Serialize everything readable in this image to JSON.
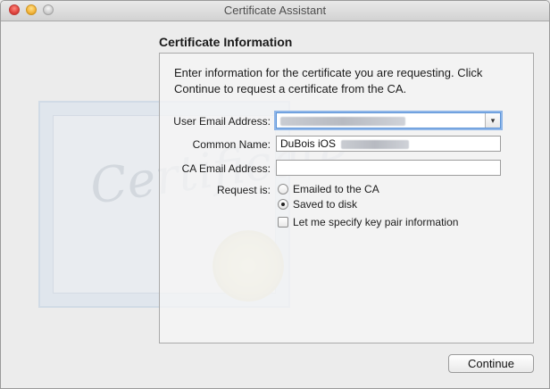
{
  "window": {
    "title": "Certificate Assistant"
  },
  "section": {
    "title": "Certificate Information"
  },
  "intro": "Enter information for the certificate you are requesting. Click Continue to request a certificate from the CA.",
  "background": {
    "certificate_word": "Certificate"
  },
  "form": {
    "user_email": {
      "label": "User Email Address:",
      "value": ""
    },
    "common_name": {
      "label": "Common Name:",
      "value": "DuBois iOS"
    },
    "ca_email": {
      "label": "CA Email Address:",
      "value": ""
    },
    "request": {
      "label": "Request is:",
      "options": [
        {
          "label": "Emailed to the CA",
          "selected": false
        },
        {
          "label": "Saved to disk",
          "selected": true
        }
      ]
    },
    "key_pair": {
      "label": "Let me specify key pair information",
      "checked": false
    }
  },
  "buttons": {
    "continue": "Continue"
  },
  "icons": {
    "combo_arrow": "▾"
  }
}
